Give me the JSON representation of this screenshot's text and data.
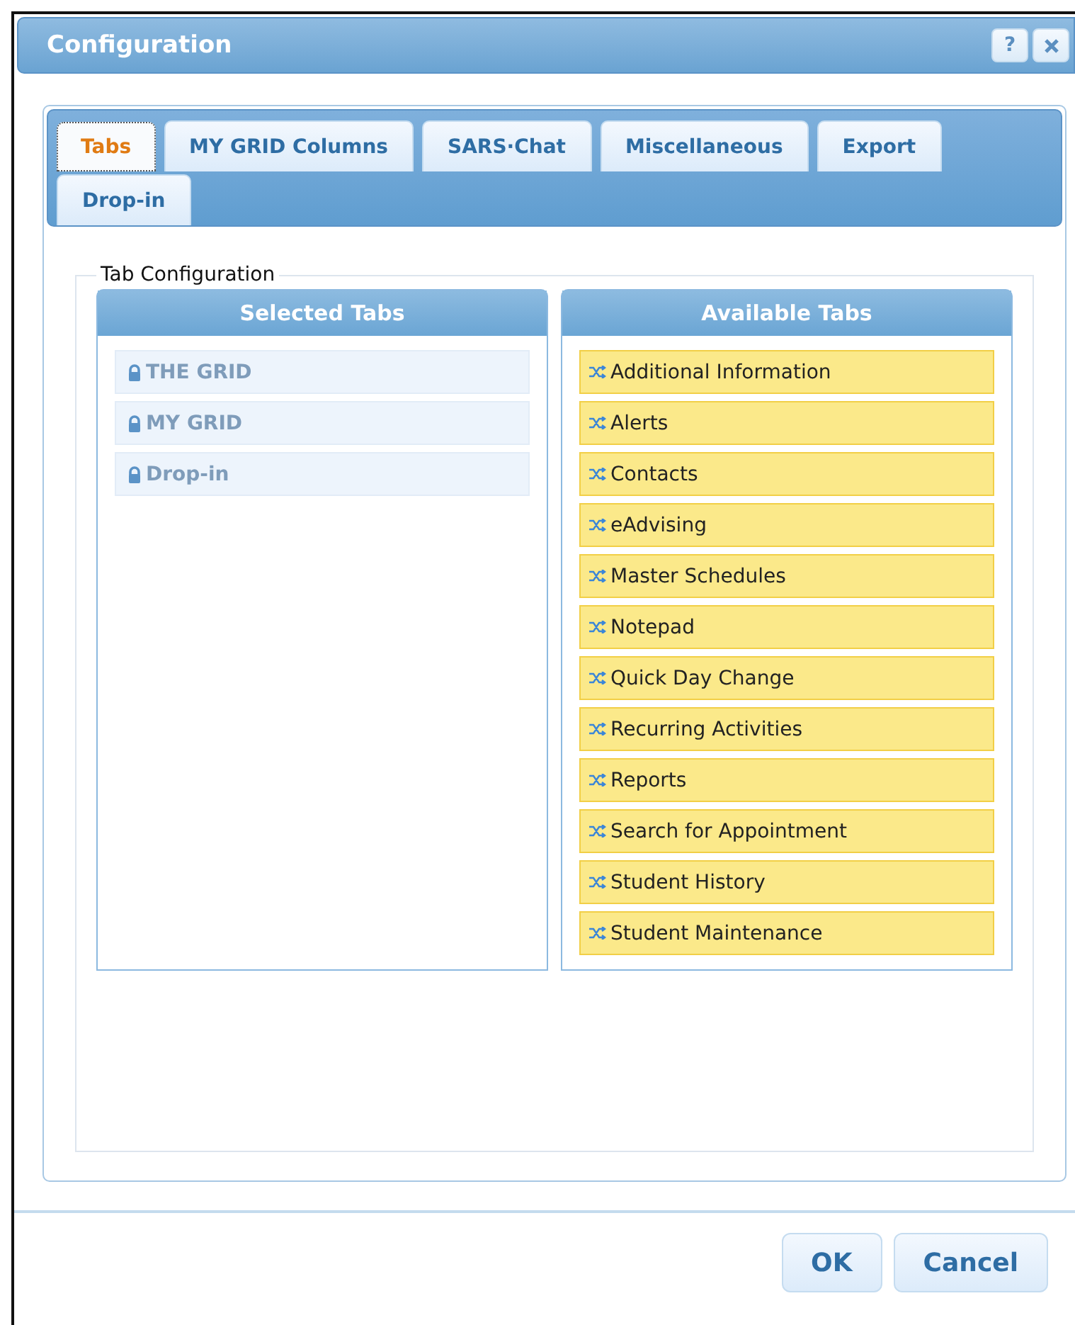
{
  "window": {
    "title": "Configuration",
    "help_button": "?"
  },
  "tabs": [
    {
      "label": "Tabs",
      "selected": true
    },
    {
      "label": "MY GRID Columns",
      "selected": false
    },
    {
      "label": "SARS·Chat",
      "selected": false
    },
    {
      "label": "Miscellaneous",
      "selected": false
    },
    {
      "label": "Export",
      "selected": false
    },
    {
      "label": "Drop-in",
      "selected": false
    }
  ],
  "group_title": "Tab Configuration",
  "selected_tabs": {
    "title": "Selected Tabs",
    "items": [
      {
        "label": "THE GRID",
        "locked": true
      },
      {
        "label": "MY GRID",
        "locked": true
      },
      {
        "label": "Drop-in",
        "locked": true
      }
    ]
  },
  "available_tabs": {
    "title": "Available Tabs",
    "items": [
      {
        "label": "Additional Information",
        "locked": false
      },
      {
        "label": "Alerts",
        "locked": false
      },
      {
        "label": "Contacts",
        "locked": false
      },
      {
        "label": "eAdvising",
        "locked": false
      },
      {
        "label": "Master Schedules",
        "locked": false
      },
      {
        "label": "Notepad",
        "locked": false
      },
      {
        "label": "Quick Day Change",
        "locked": false
      },
      {
        "label": "Recurring Activities",
        "locked": false
      },
      {
        "label": "Reports",
        "locked": false
      },
      {
        "label": "Search for Appointment",
        "locked": false
      },
      {
        "label": "Student History",
        "locked": false
      },
      {
        "label": "Student Maintenance",
        "locked": false
      }
    ]
  },
  "buttons": [
    "OK",
    "Cancel"
  ]
}
